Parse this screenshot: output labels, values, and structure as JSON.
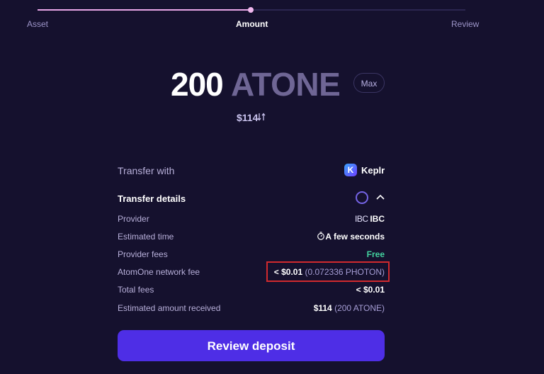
{
  "stepper": {
    "steps": [
      {
        "label": "Asset",
        "active": false
      },
      {
        "label": "Amount",
        "active": true
      },
      {
        "label": "Review",
        "active": false
      }
    ],
    "progress_color": "#e8a6e8"
  },
  "amount": {
    "value": "200",
    "unit": "ATONE",
    "max_label": "Max",
    "fiat": "$114",
    "swap_icon": "swap-vertical-icon"
  },
  "transfer_with": {
    "label": "Transfer with",
    "wallet_icon_letter": "K",
    "wallet_name": "Keplr"
  },
  "details": {
    "title": "Transfer details",
    "loading_icon": "spinner-icon",
    "collapse_icon": "chevron-up-icon",
    "rows": {
      "provider": {
        "label": "Provider",
        "icon_text": "IBC",
        "value": "IBC"
      },
      "time": {
        "label": "Estimated time",
        "icon": "timer-icon",
        "value": "A few seconds"
      },
      "provider_fees": {
        "label": "Provider fees",
        "value": "Free"
      },
      "network_fee": {
        "label": "AtomOne network fee",
        "value": "< $0.01",
        "sub": "(0.072336 PHOTON)"
      },
      "total_fees": {
        "label": "Total fees",
        "value": "< $0.01"
      },
      "received": {
        "label": "Estimated amount received",
        "value": "$114",
        "sub": "(200 ATONE)"
      }
    }
  },
  "actions": {
    "review_label": "Review deposit"
  },
  "colors": {
    "background": "#15112e",
    "accent": "#4e2ee6",
    "free": "#43d39f",
    "highlight": "#d12a2e"
  }
}
